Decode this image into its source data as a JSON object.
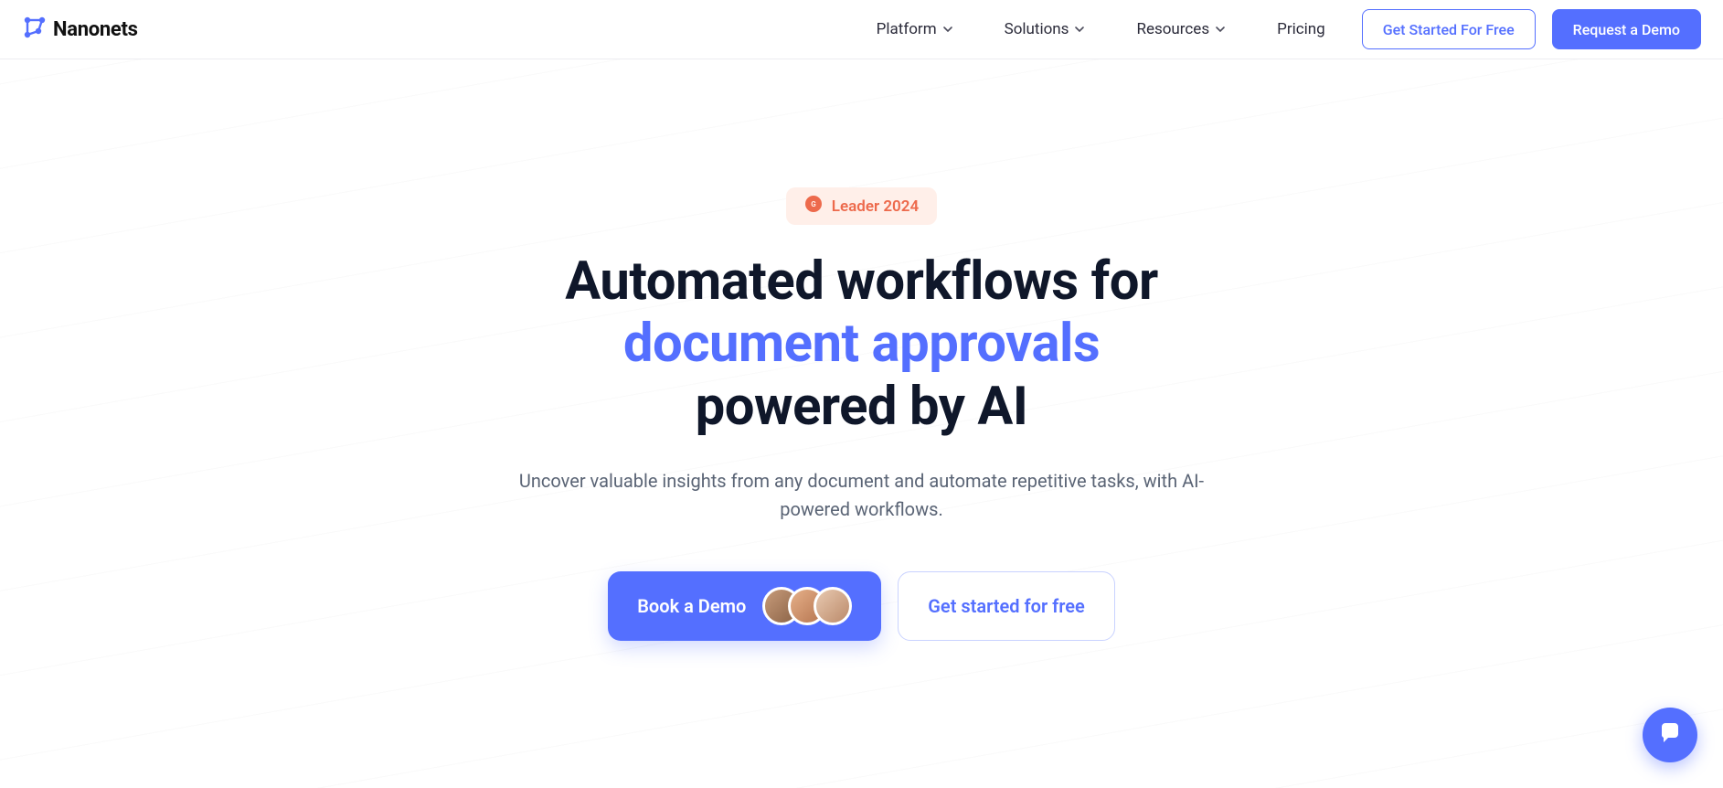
{
  "brand": {
    "name": "Nanonets"
  },
  "nav": {
    "items": [
      {
        "label": "Platform",
        "has_dropdown": true
      },
      {
        "label": "Solutions",
        "has_dropdown": true
      },
      {
        "label": "Resources",
        "has_dropdown": true
      },
      {
        "label": "Pricing",
        "has_dropdown": false
      }
    ],
    "cta_outline": "Get Started For Free",
    "cta_primary": "Request a Demo"
  },
  "hero": {
    "badge": "Leader 2024",
    "headline_line1": "Automated workflows for",
    "headline_accent": "document approvals",
    "headline_line3": "powered by AI",
    "subtitle": "Uncover valuable insights from any document and automate repetitive tasks, with AI-powered workflows.",
    "cta_primary": "Book a Demo",
    "cta_secondary": "Get started for free"
  },
  "colors": {
    "accent": "#546FFF",
    "badge_bg": "#FFEFE9",
    "badge_fg": "#ED6A4C"
  }
}
